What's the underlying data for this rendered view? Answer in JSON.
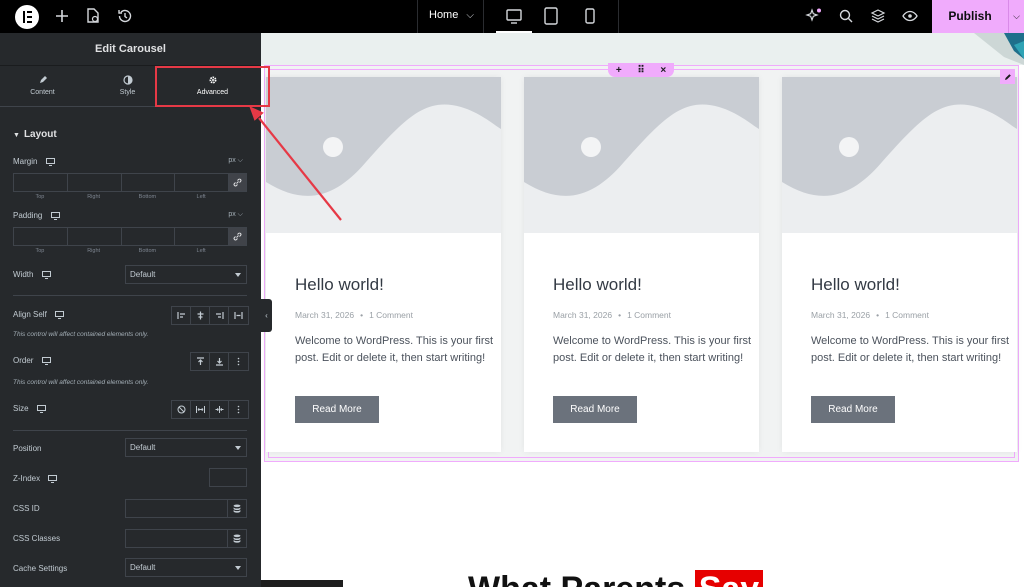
{
  "topbar": {
    "page_name": "Home",
    "publish_label": "Publish",
    "icons": [
      "elementor-logo-icon",
      "add-icon",
      "page-settings-icon",
      "history-icon",
      "ai-icon",
      "search-icon",
      "structure-icon",
      "preview-icon"
    ],
    "devices": [
      "desktop",
      "tablet",
      "mobile"
    ],
    "accent_color": "#f0abfc"
  },
  "panel": {
    "title": "Edit Carousel",
    "tabs": [
      {
        "label": "Content",
        "icon": "pencil-icon"
      },
      {
        "label": "Style",
        "icon": "half-circle-icon"
      },
      {
        "label": "Advanced",
        "icon": "gear-icon",
        "active": true
      }
    ],
    "section": "Layout",
    "margin": {
      "label": "Margin",
      "unit": "px",
      "sides": [
        "Top",
        "Right",
        "Bottom",
        "Left"
      ]
    },
    "padding": {
      "label": "Padding",
      "unit": "px",
      "sides": [
        "Top",
        "Right",
        "Bottom",
        "Left"
      ]
    },
    "width": {
      "label": "Width",
      "value": "Default"
    },
    "align_self": {
      "label": "Align Self",
      "hint": "This control will affect contained elements only."
    },
    "order": {
      "label": "Order",
      "hint": "This control will affect contained elements only."
    },
    "size": {
      "label": "Size"
    },
    "position": {
      "label": "Position",
      "value": "Default"
    },
    "z_index": {
      "label": "Z-Index"
    },
    "css_id": {
      "label": "CSS ID"
    },
    "css_classes": {
      "label": "CSS Classes"
    },
    "cache_settings": {
      "label": "Cache Settings",
      "value": "Default"
    }
  },
  "posts": [
    {
      "title": "Hello world!",
      "date": "March 31, 2026",
      "comments": "1 Comment",
      "excerpt": "Welcome to WordPress. This is your first post. Edit or delete it, then start writing!",
      "button": "Read More"
    },
    {
      "title": "Hello world!",
      "date": "March 31, 2026",
      "comments": "1 Comment",
      "excerpt": "Welcome to WordPress. This is your first post. Edit or delete it, then start writing!",
      "button": "Read More"
    },
    {
      "title": "Hello world!",
      "date": "March 31, 2026",
      "comments": "1 Comment",
      "excerpt": "Welcome to WordPress. This is your first post. Edit or delete it, then start writing!",
      "button": "Read More"
    }
  ],
  "bottom_heading": {
    "text": "What Parents ",
    "highlight": "Say"
  }
}
